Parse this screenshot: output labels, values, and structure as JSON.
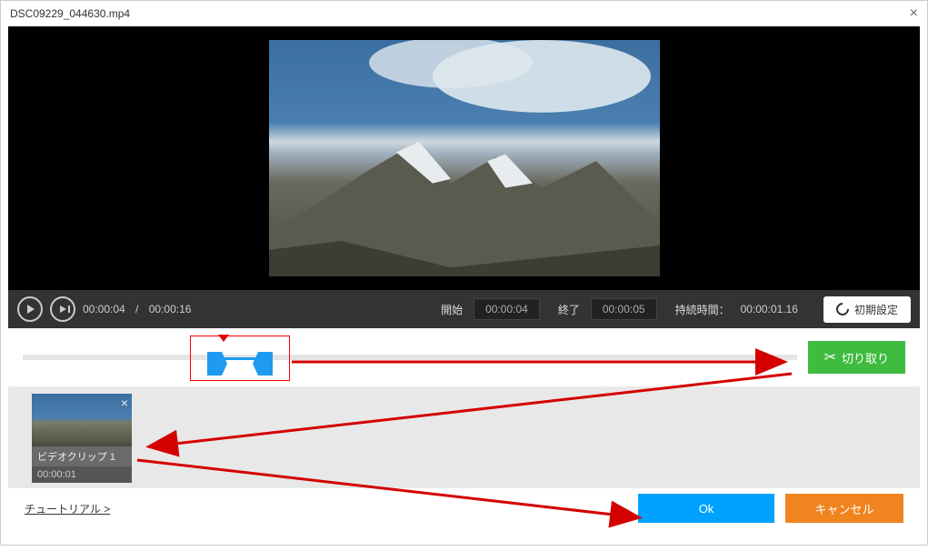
{
  "titlebar": {
    "filename": "DSC09229_044630.mp4"
  },
  "controls": {
    "current_time": "00:00:04",
    "total_time": "00:00:16",
    "start_label": "開始",
    "start_value": "00:00:04",
    "end_label": "終了",
    "end_value": "00:00:05",
    "duration_label": "持続時間：",
    "duration_value": "00:00:01.16",
    "reset_label": "初期設定"
  },
  "slider": {
    "cut_label": "切り取り"
  },
  "clip": {
    "label": "ビデオクリップ 1",
    "time": "00:00:01"
  },
  "footer": {
    "tutorial": "チュートリアル >",
    "ok": "Ok",
    "cancel": "キャンセル"
  },
  "icons": {
    "close": "close-icon",
    "play": "play-icon",
    "step": "step-icon",
    "reset": "reset-icon",
    "scissors": "scissors-icon",
    "clip_close": "clip-close-icon"
  }
}
